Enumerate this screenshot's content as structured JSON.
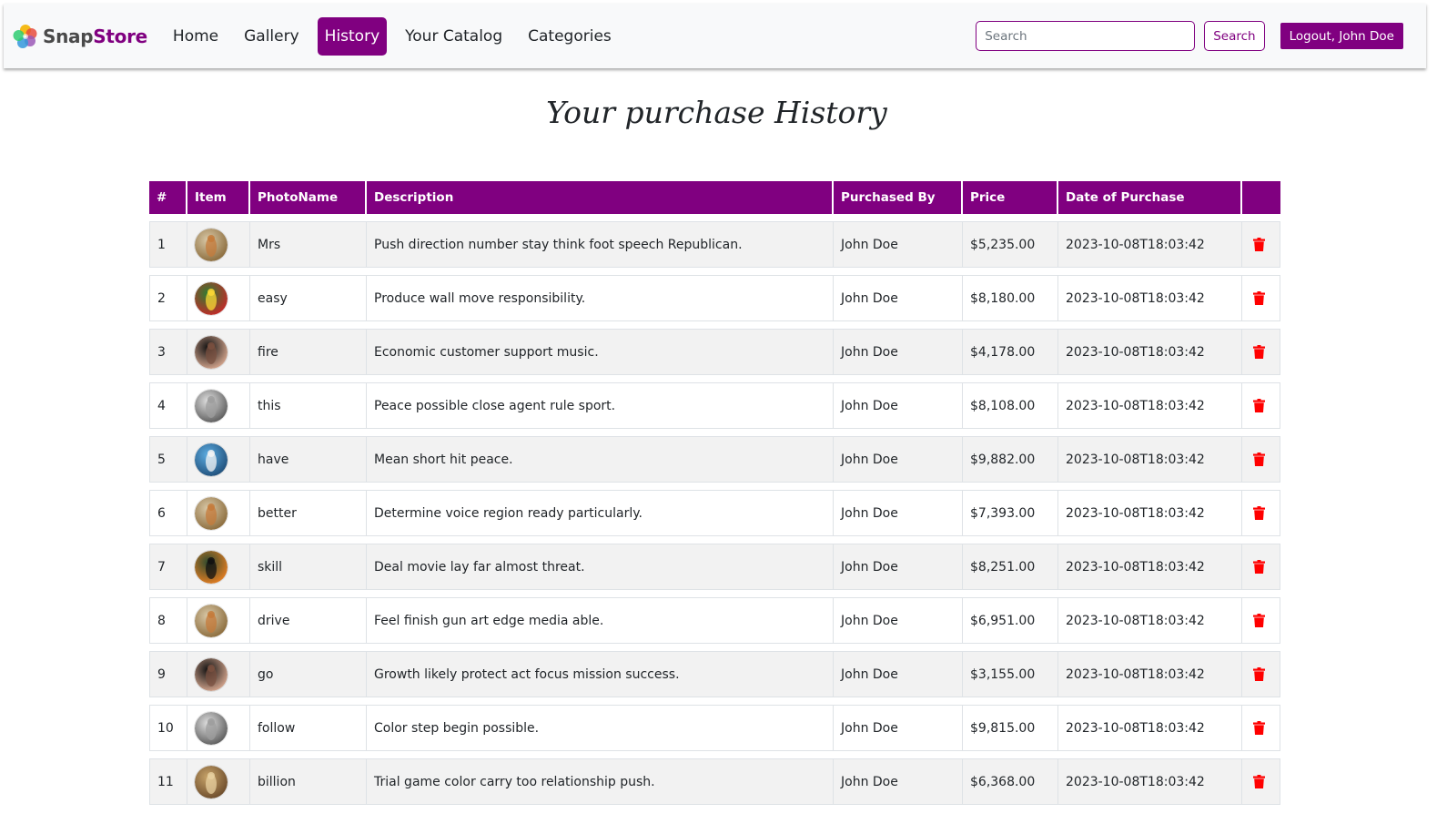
{
  "brand": {
    "part1": "Snap",
    "part2": "Store"
  },
  "nav": [
    {
      "label": "Home",
      "active": false
    },
    {
      "label": "Gallery",
      "active": false
    },
    {
      "label": "History",
      "active": true
    },
    {
      "label": "Your Catalog",
      "active": false
    },
    {
      "label": "Categories",
      "active": false
    }
  ],
  "search": {
    "placeholder": "Search",
    "button_label": "Search"
  },
  "logout_label": "Logout, John Doe",
  "page_title": "Your purchase History",
  "table": {
    "headers": [
      "#",
      "Item",
      "PhotoName",
      "Description",
      "Purchased By",
      "Price",
      "Date of Purchase",
      ""
    ],
    "rows": [
      {
        "num": "1",
        "thumb": "statue",
        "name": "Mrs",
        "description": "Push direction number stay think foot speech Republican.",
        "buyer": "John Doe",
        "price": "$5,235.00",
        "date": "2023-10-08T18:03:42"
      },
      {
        "num": "2",
        "thumb": "parrot",
        "name": "easy",
        "description": "Produce wall move responsibility.",
        "buyer": "John Doe",
        "price": "$8,180.00",
        "date": "2023-10-08T18:03:42"
      },
      {
        "num": "3",
        "thumb": "portrait",
        "name": "fire",
        "description": "Economic customer support music.",
        "buyer": "John Doe",
        "price": "$4,178.00",
        "date": "2023-10-08T18:03:42"
      },
      {
        "num": "4",
        "thumb": "disco",
        "name": "this",
        "description": "Peace possible close agent rule sport.",
        "buyer": "John Doe",
        "price": "$8,108.00",
        "date": "2023-10-08T18:03:42"
      },
      {
        "num": "5",
        "thumb": "tower",
        "name": "have",
        "description": "Mean short hit peace.",
        "buyer": "John Doe",
        "price": "$9,882.00",
        "date": "2023-10-08T18:03:42"
      },
      {
        "num": "6",
        "thumb": "statue",
        "name": "better",
        "description": "Determine voice region ready particularly.",
        "buyer": "John Doe",
        "price": "$7,393.00",
        "date": "2023-10-08T18:03:42"
      },
      {
        "num": "7",
        "thumb": "butterfly",
        "name": "skill",
        "description": "Deal movie lay far almost threat.",
        "buyer": "John Doe",
        "price": "$8,251.00",
        "date": "2023-10-08T18:03:42"
      },
      {
        "num": "8",
        "thumb": "statue",
        "name": "drive",
        "description": "Feel finish gun art edge media able.",
        "buyer": "John Doe",
        "price": "$6,951.00",
        "date": "2023-10-08T18:03:42"
      },
      {
        "num": "9",
        "thumb": "portrait",
        "name": "go",
        "description": "Growth likely protect act focus mission success.",
        "buyer": "John Doe",
        "price": "$3,155.00",
        "date": "2023-10-08T18:03:42"
      },
      {
        "num": "10",
        "thumb": "disco",
        "name": "follow",
        "description": "Color step begin possible.",
        "buyer": "John Doe",
        "price": "$9,815.00",
        "date": "2023-10-08T18:03:42"
      },
      {
        "num": "11",
        "thumb": "horse",
        "name": "billion",
        "description": "Trial game color carry too relationship push.",
        "buyer": "John Doe",
        "price": "$6,368.00",
        "date": "2023-10-08T18:03:42"
      }
    ]
  },
  "colors": {
    "accent": "#800080",
    "delete": "#ff0000",
    "row_stripe": "#f2f2f2"
  },
  "icons": {
    "delete": "trash-icon",
    "logo": "flower-logo-icon"
  }
}
